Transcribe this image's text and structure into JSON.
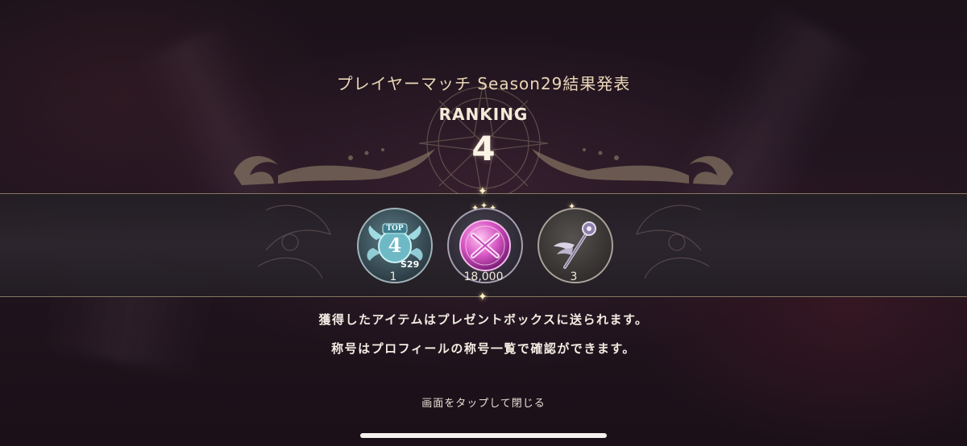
{
  "screen": {
    "title": "プレイヤーマッチ Season29結果発表",
    "ranking_label": "RANKING",
    "ranking_value": "4"
  },
  "rewards": [
    {
      "icon": "top-rank-title-badge-icon",
      "badge_top_label": "TOP",
      "badge_number": "4",
      "season_tag": "S29",
      "count": "1"
    },
    {
      "icon": "pink-crystal-orb-icon",
      "count": "18,000"
    },
    {
      "icon": "winged-staff-icon",
      "count": "3"
    }
  ],
  "messages": {
    "line1": "獲得したアイテムはプレゼントボックスに送られます。",
    "line2": "称号はプロフィールの称号一覧で確認ができます。"
  },
  "footer": {
    "tap_to_close": "画面をタップして閉じる"
  },
  "colors": {
    "gold_text": "#ead6b8",
    "band_border": "#d7c396",
    "background": "#1c121a"
  }
}
